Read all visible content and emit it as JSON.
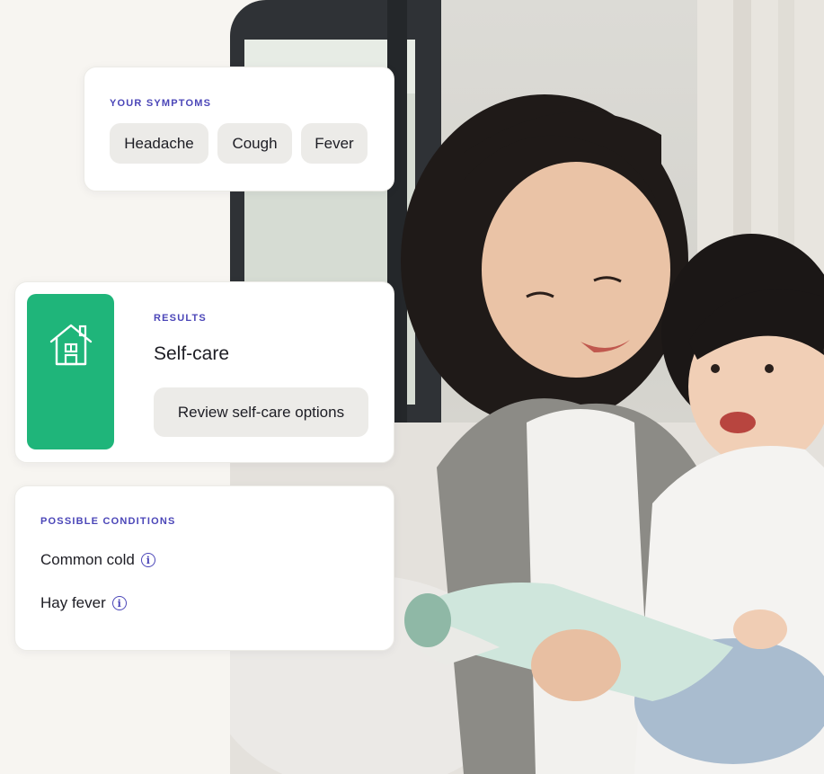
{
  "symptoms": {
    "heading": "YOUR SYMPTOMS",
    "chips": [
      "Headache",
      "Cough",
      "Fever"
    ]
  },
  "results": {
    "heading": "RESULTS",
    "title": "Self-care",
    "button_label": "Review self-care options",
    "tile_icon": "house-icon",
    "tile_color": "#1fb57a"
  },
  "conditions": {
    "heading": "POSSIBLE CONDITIONS",
    "items": [
      "Common cold",
      "Hay fever"
    ],
    "item_icon": "info-icon"
  },
  "colors": {
    "accent": "#4b46b8",
    "chip_bg": "#ecebe8",
    "page_bg": "#f7f5f1"
  }
}
